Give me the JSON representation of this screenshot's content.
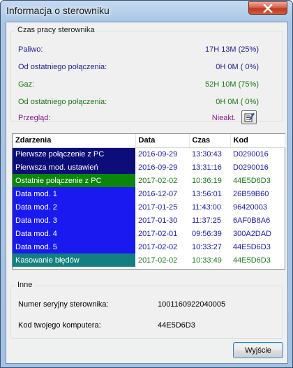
{
  "window": {
    "title": "Informacja o sterowniku"
  },
  "work_time": {
    "group_title": "Czas pracy sterownika",
    "rows": [
      {
        "label": "Paliwo:",
        "value": "17H 13M (25%)"
      },
      {
        "label": "Od ostatniego połączenia:",
        "value": "0H  0M ( 0%)"
      },
      {
        "label": "Gaz:",
        "value": "52H 10M (75%)"
      },
      {
        "label": "Od ostatniego połączenia:",
        "value": "0H  0M ( 0%)"
      },
      {
        "label": "Przegląd:",
        "value": "Nieakt."
      }
    ],
    "colors": {
      "fuel": "#1f1f8f",
      "gas": "#1c7a1c",
      "review": "#8a1f8a"
    },
    "review_button_icon": "edit-document-icon"
  },
  "events_table": {
    "headers": [
      "Zdarzenia",
      "Data",
      "Czas",
      "Kod"
    ],
    "rows": [
      {
        "event": "Pierwsze połączenie z PC",
        "date": "2016-09-29",
        "time": "13:30:43",
        "code": "D0290016",
        "color": "#0d0d7a"
      },
      {
        "event": "Pierwsza mod. ustawień",
        "date": "2016-09-29",
        "time": "13:31:16",
        "code": "D0290016",
        "color": "#0d0d7a"
      },
      {
        "event": "Ostatnie połączenie z PC",
        "date": "2017-02-02",
        "time": "10:36:19",
        "code": "44E5D6D3",
        "color": "#0a860a"
      },
      {
        "event": "Data mod. 1",
        "date": "2016-12-07",
        "time": "13:56:01",
        "code": "26B59B60",
        "color": "#1a1af0"
      },
      {
        "event": "Data mod. 2",
        "date": "2017-01-25",
        "time": "11:43:00",
        "code": "96420003",
        "color": "#1a1af0"
      },
      {
        "event": "Data mod. 3",
        "date": "2017-01-30",
        "time": "11:37:25",
        "code": "6AF0B8A6",
        "color": "#1a1af0"
      },
      {
        "event": "Data mod. 4",
        "date": "2017-02-01",
        "time": "09:56:39",
        "code": "300A2DAD",
        "color": "#1a1af0"
      },
      {
        "event": "Data mod. 5",
        "date": "2017-02-02",
        "time": "10:33:27",
        "code": "44E5D6D3",
        "color": "#1a1af0"
      },
      {
        "event": "Kasowanie błędów",
        "date": "2017-02-02",
        "time": "10:33:49",
        "code": "44E5D6D3",
        "color": "#128080"
      }
    ]
  },
  "other": {
    "group_title": "Inne",
    "serial_label": "Numer seryjny sterownika:",
    "serial_value": "1001160922040005",
    "computer_code_label": "Kod twojego komputera:",
    "computer_code_value": "44E5D6D3"
  },
  "buttons": {
    "exit": "Wyjście",
    "close_icon": "close-icon"
  }
}
